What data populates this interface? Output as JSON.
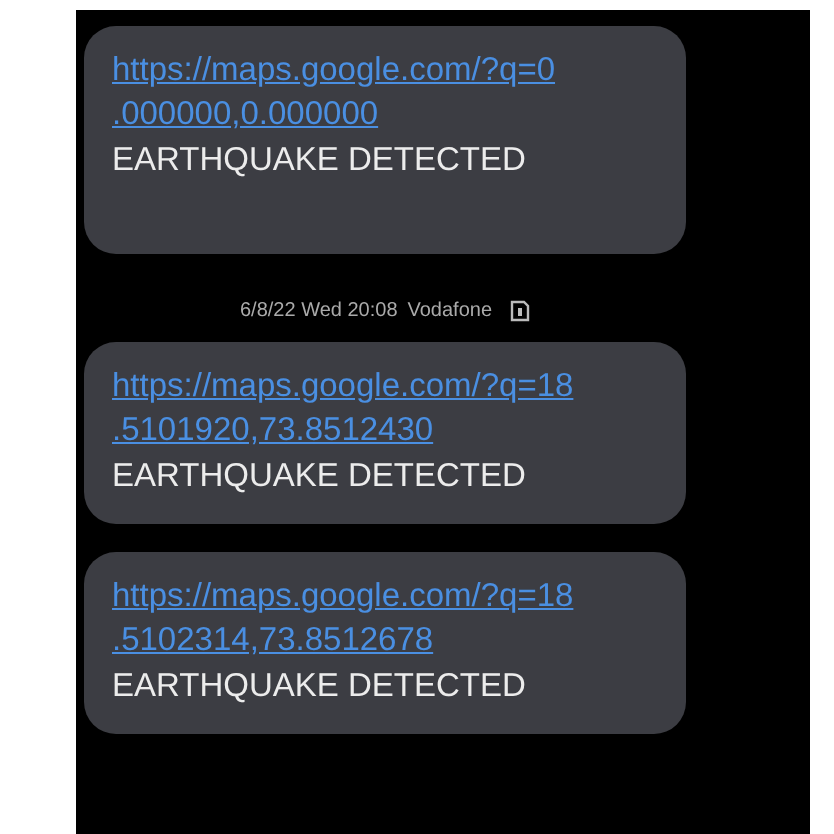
{
  "messages": [
    {
      "link_lines": [
        "https://maps.google.com/?q=0",
        ".000000,0.000000"
      ],
      "text": "EARTHQUAKE DETECTED"
    },
    {
      "timestamp": "6/8/22 Wed 20:08",
      "carrier": "Vodafone",
      "link_lines": [
        "https://maps.google.com/?q=18",
        ".5101920,73.8512430"
      ],
      "text": "EARTHQUAKE DETECTED"
    },
    {
      "link_lines": [
        "https://maps.google.com/?q=18",
        ".5102314,73.8512678"
      ],
      "text": "EARTHQUAKE DETECTED"
    }
  ]
}
